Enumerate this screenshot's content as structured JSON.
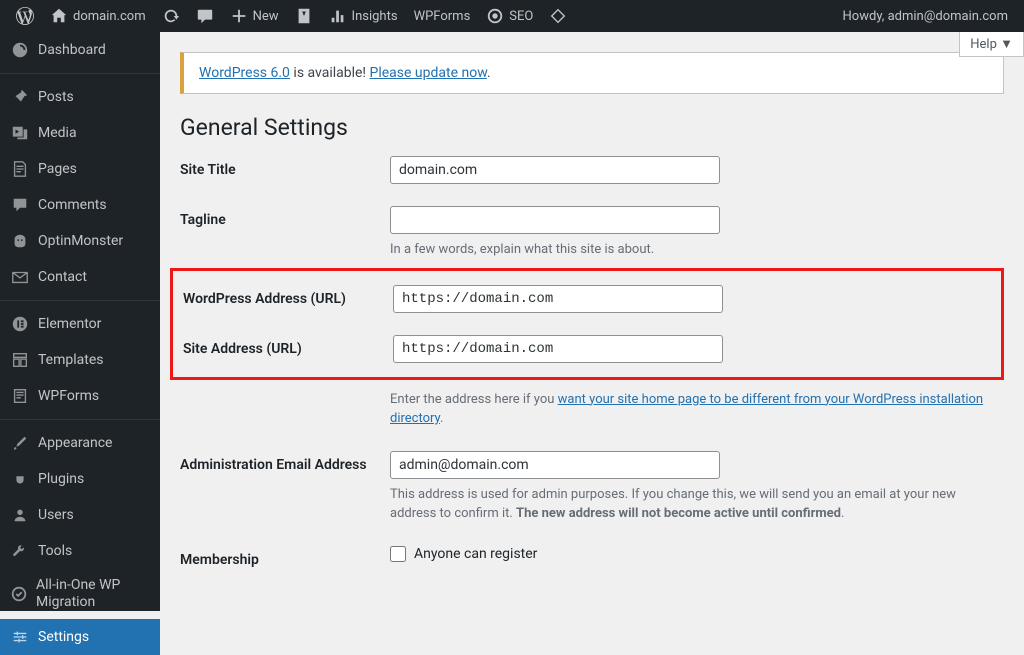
{
  "adminbar": {
    "site_name": "domain.com",
    "new_label": "New",
    "insights_label": "Insights",
    "wpforms_label": "WPForms",
    "seo_label": "SEO",
    "howdy": "Howdy, admin@domain.com"
  },
  "sidebar": {
    "dashboard": "Dashboard",
    "posts": "Posts",
    "media": "Media",
    "pages": "Pages",
    "comments": "Comments",
    "optin": "OptinMonster",
    "contact": "Contact",
    "elementor": "Elementor",
    "templates": "Templates",
    "wpforms": "WPForms",
    "appearance": "Appearance",
    "plugins": "Plugins",
    "users": "Users",
    "tools": "Tools",
    "aio": "All-in-One WP Migration",
    "settings": "Settings"
  },
  "help_label": "Help ▼",
  "notice": {
    "prefix": "WordPress 6.0",
    "mid": " is available! ",
    "link": "Please update now",
    "suffix": "."
  },
  "page_title": "General Settings",
  "fields": {
    "site_title": {
      "label": "Site Title",
      "value": "domain.com"
    },
    "tagline": {
      "label": "Tagline",
      "value": "",
      "desc": "In a few words, explain what this site is about."
    },
    "wp_url": {
      "label": "WordPress Address (URL)",
      "value": "https://domain.com"
    },
    "site_url": {
      "label": "Site Address (URL)",
      "value": "https://domain.com",
      "desc_pre": "Enter the address here if you ",
      "desc_link": "want your site home page to be different from your WordPress installation directory",
      "desc_post": "."
    },
    "admin_email": {
      "label": "Administration Email Address",
      "value": "admin@domain.com",
      "desc_pre": "This address is used for admin purposes. If you change this, we will send you an email at your new address to confirm it. ",
      "desc_bold": "The new address will not become active until confirmed",
      "desc_post": "."
    },
    "membership": {
      "label": "Membership",
      "chk_label": "Anyone can register"
    }
  }
}
